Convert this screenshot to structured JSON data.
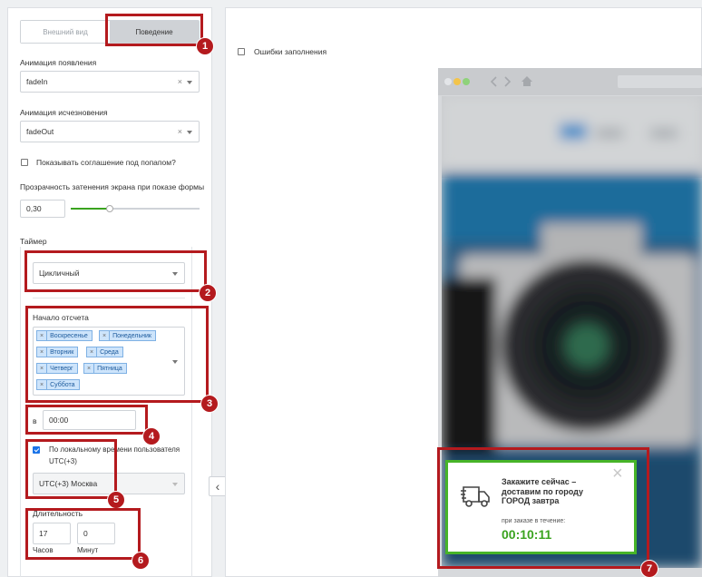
{
  "tabs": {
    "appearance": "Внешний вид",
    "behavior": "Поведение"
  },
  "appear_animation": {
    "label": "Анимация появления",
    "value": "fadeIn",
    "clear": "×"
  },
  "disappear_animation": {
    "label": "Анимация исчезновения",
    "value": "fadeOut",
    "clear": "×"
  },
  "agreement_checkbox": {
    "label": "Показывать соглашение под попапом?",
    "checked": false
  },
  "opacity": {
    "label": "Прозрачность затенения экрана при показе формы",
    "value": "0,30",
    "slider_fraction": 0.3
  },
  "timer": {
    "label": "Таймер",
    "mode": "Цикличный"
  },
  "start": {
    "label": "Начало отсчета",
    "days": [
      "Воскресенье",
      "Понедельник",
      "Вторник",
      "Среда",
      "Четверг",
      "Пятница",
      "Суббота"
    ],
    "remove_glyph": "×"
  },
  "time": {
    "prefix": "в",
    "value": "00:00"
  },
  "local_time": {
    "label": "По локальному времени пользователя",
    "checked": true,
    "tz_hint": "UTC(+3)",
    "tz_value": "UTC(+3) Москва"
  },
  "duration": {
    "label": "Длительность",
    "hours_value": "17",
    "hours_label": "Часов",
    "minutes_value": "0",
    "minutes_label": "Минут"
  },
  "fill_errors": {
    "label": "Ошибки заполнения",
    "checked": false
  },
  "badges": [
    "1",
    "2",
    "3",
    "4",
    "5",
    "6",
    "7"
  ],
  "popup": {
    "title": "Закажите сейчас – доставим по городу ГОРОД завтра",
    "subtitle": "при заказе в течение:",
    "countdown": "00:10:11",
    "close": "×"
  },
  "collapse_glyph": "‹",
  "colors": {
    "annotation": "#b41a1e",
    "popup_border": "#47b428",
    "countdown": "#3aa31f",
    "slider": "#3aa31f"
  },
  "icons": [
    "truck-icon",
    "close-icon",
    "chevron-left-icon",
    "home-icon",
    "camera-image"
  ]
}
